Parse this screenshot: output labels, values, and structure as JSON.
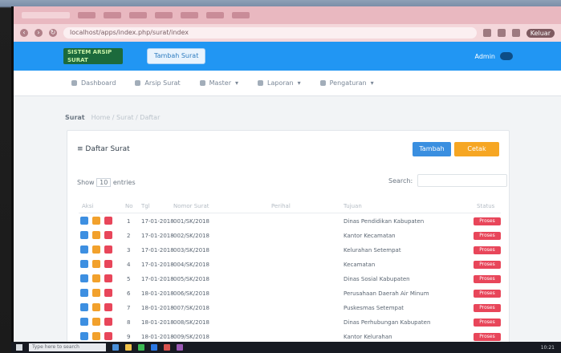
{
  "browser": {
    "url": "localhost/apps/index.php/surat/index",
    "profile_label": "Keluar"
  },
  "app": {
    "logo_line1": "SISTEM ARSIP",
    "logo_line2": "SURAT",
    "header_button": "Tambah Surat",
    "user_name": "Admin"
  },
  "menu": [
    {
      "label": "Dashboard",
      "icon": "home-icon"
    },
    {
      "label": "Arsip Surat",
      "icon": "archive-icon"
    },
    {
      "label": "Master",
      "icon": "grid-icon"
    },
    {
      "label": "Laporan",
      "icon": "report-icon"
    },
    {
      "label": "Pengaturan",
      "icon": "settings-icon"
    }
  ],
  "breadcrumb": {
    "current": "Surat",
    "path": "Home / Surat / Daftar"
  },
  "card": {
    "title": "Daftar Surat",
    "button_blue": "Tambah",
    "button_yellow": "Cetak",
    "entries_label": "Show",
    "entries_value": "10",
    "entries_suffix": "entries",
    "search_label": "Search:"
  },
  "table": {
    "headers": [
      "Aksi",
      "No",
      "Tgl",
      "Nomor Surat",
      "Perihal",
      "Tujuan",
      "Status"
    ],
    "rows": [
      {
        "no": "1",
        "date": "17-01-2018",
        "number": "001/SK/2018",
        "subject": "",
        "dest": "Dinas Pendidikan Kabupaten",
        "status": "Proses"
      },
      {
        "no": "2",
        "date": "17-01-2018",
        "number": "002/SK/2018",
        "subject": "",
        "dest": "Kantor Kecamatan",
        "status": "Proses"
      },
      {
        "no": "3",
        "date": "17-01-2018",
        "number": "003/SK/2018",
        "subject": "",
        "dest": "Kelurahan Setempat",
        "status": "Proses"
      },
      {
        "no": "4",
        "date": "17-01-2018",
        "number": "004/SK/2018",
        "subject": "",
        "dest": "Kecamatan",
        "status": "Proses"
      },
      {
        "no": "5",
        "date": "17-01-2018",
        "number": "005/SK/2018",
        "subject": "",
        "dest": "Dinas Sosial Kabupaten",
        "status": "Proses"
      },
      {
        "no": "6",
        "date": "18-01-2018",
        "number": "006/SK/2018",
        "subject": "",
        "dest": "Perusahaan Daerah Air Minum",
        "status": "Proses"
      },
      {
        "no": "7",
        "date": "18-01-2018",
        "number": "007/SK/2018",
        "subject": "",
        "dest": "Puskesmas Setempat",
        "status": "Proses"
      },
      {
        "no": "8",
        "date": "18-01-2018",
        "number": "008/SK/2018",
        "subject": "",
        "dest": "Dinas Perhubungan Kabupaten",
        "status": "Proses"
      },
      {
        "no": "9",
        "date": "18-01-2018",
        "number": "009/SK/2018",
        "subject": "",
        "dest": "Kantor Kelurahan",
        "status": "Proses"
      }
    ]
  },
  "taskbar": {
    "search_placeholder": "Type here to search",
    "clock": "10:21"
  }
}
